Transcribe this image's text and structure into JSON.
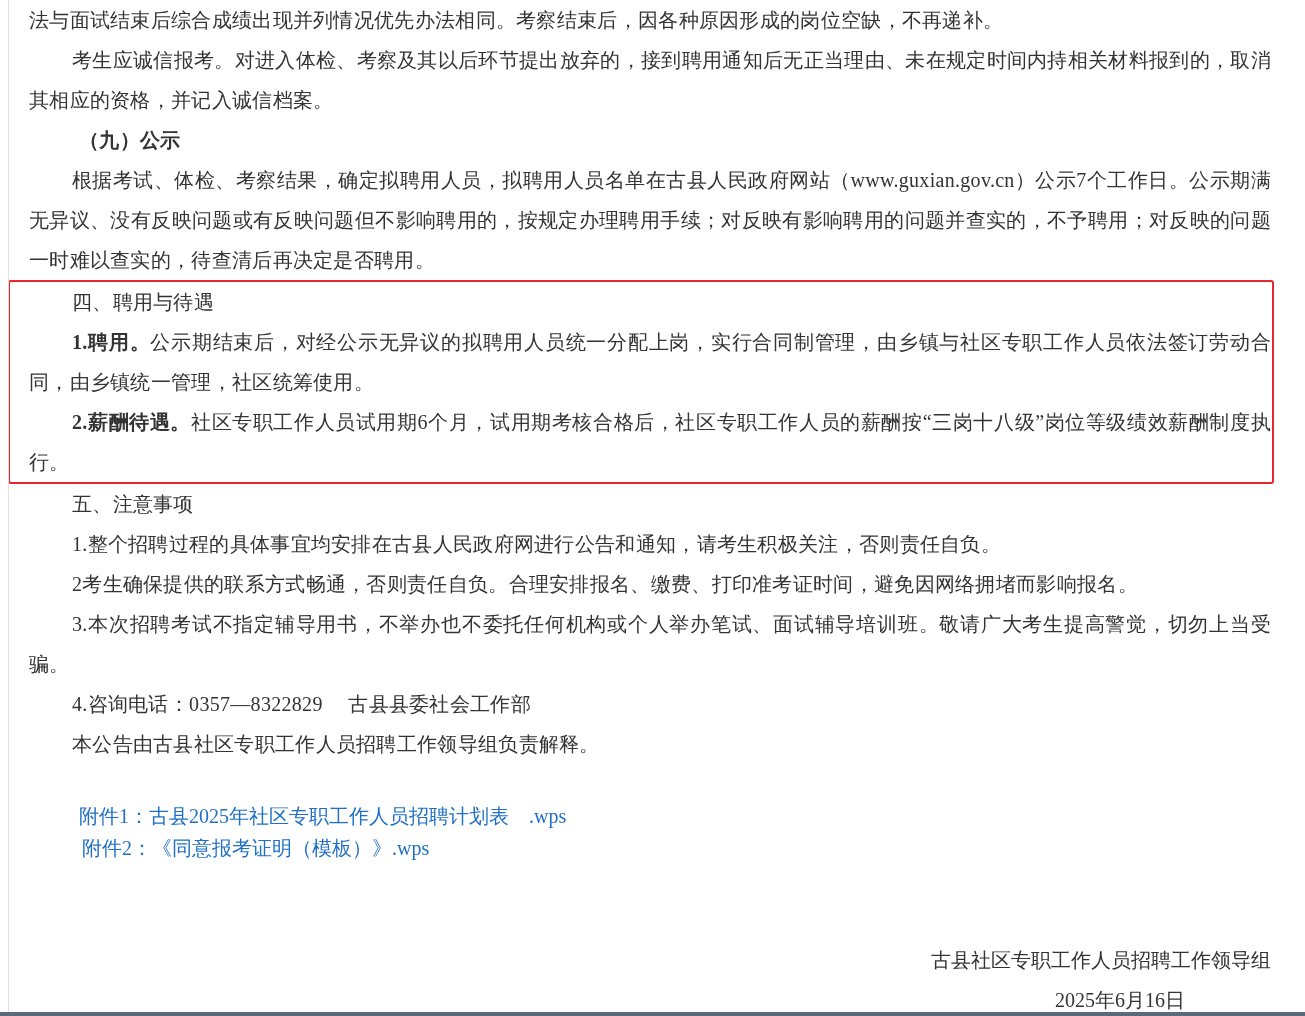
{
  "blocks": [
    {
      "kind": "continuation",
      "text": "法与面试结束后综合成绩出现并列情况优先办法相同。考察结束后，因各种原因形成的岗位空缺，不再递补。"
    },
    {
      "kind": "paragraph",
      "text": "考生应诚信报考。对进入体检、考察及其以后环节提出放弃的，接到聘用通知后无正当理由、未在规定时间内持相关材料报到的，取消其相应的资格，并记入诚信档案。"
    },
    {
      "kind": "subheading",
      "text": "（九）公示"
    },
    {
      "kind": "paragraph",
      "text": "根据考试、体检、考察结果，确定拟聘用人员，拟聘用人员名单在古县人民政府网站（www.guxian.gov.cn）公示7个工作日。公示期满无异议、没有反映问题或有反映问题但不影响聘用的，按规定办理聘用手续；对反映有影响聘用的问题并查实的，不予聘用；对反映的问题一时难以查实的，待查清后再决定是否聘用。"
    }
  ],
  "highlight_box": [
    {
      "kind": "paragraph",
      "text": "四、聘用与待遇"
    },
    {
      "kind": "paragraph",
      "text": "**1.聘用。**公示期结束后，对经公示无异议的拟聘用人员统一分配上岗，实行合同制管理，由乡镇与社区专职工作人员依法签订劳动合同，由乡镇统一管理，社区统筹使用。"
    },
    {
      "kind": "paragraph",
      "text": "**2.薪酬待遇。**社区专职工作人员试用期6个月，试用期考核合格后，社区专职工作人员的薪酬按“三岗十八级”岗位等级绩效薪酬制度执行。"
    }
  ],
  "blocks_after": [
    {
      "kind": "paragraph",
      "text": "五、注意事项"
    },
    {
      "kind": "paragraph",
      "text": "1.整个招聘过程的具体事宜均安排在古县人民政府网进行公告和通知，请考生积极关注，否则责任自负。"
    },
    {
      "kind": "paragraph",
      "text": "2考生确保提供的联系方式畅通，否则责任自负。合理安排报名、缴费、打印准考证时间，避免因网络拥堵而影响报名。"
    },
    {
      "kind": "paragraph",
      "text": "3.本次招聘考试不指定辅导用书，不举办也不委托任何机构或个人举办笔试、面试辅导培训班。敬请广大考生提高警觉，切勿上当受骗。"
    },
    {
      "kind": "paragraph",
      "text": "4.咨询电话：0357—8322829　 古县县委社会工作部"
    },
    {
      "kind": "paragraph",
      "text": "本公告由古县社区专职工作人员招聘工作领导组负责解释。"
    }
  ],
  "attachments": [
    "附件1：古县2025年社区专职工作人员招聘计划表　.wps",
    "附件2：《同意报考证明（模板）》.wps"
  ],
  "signature": "古县社区专职工作人员招聘工作领导组",
  "date": "2025年6月16日"
}
